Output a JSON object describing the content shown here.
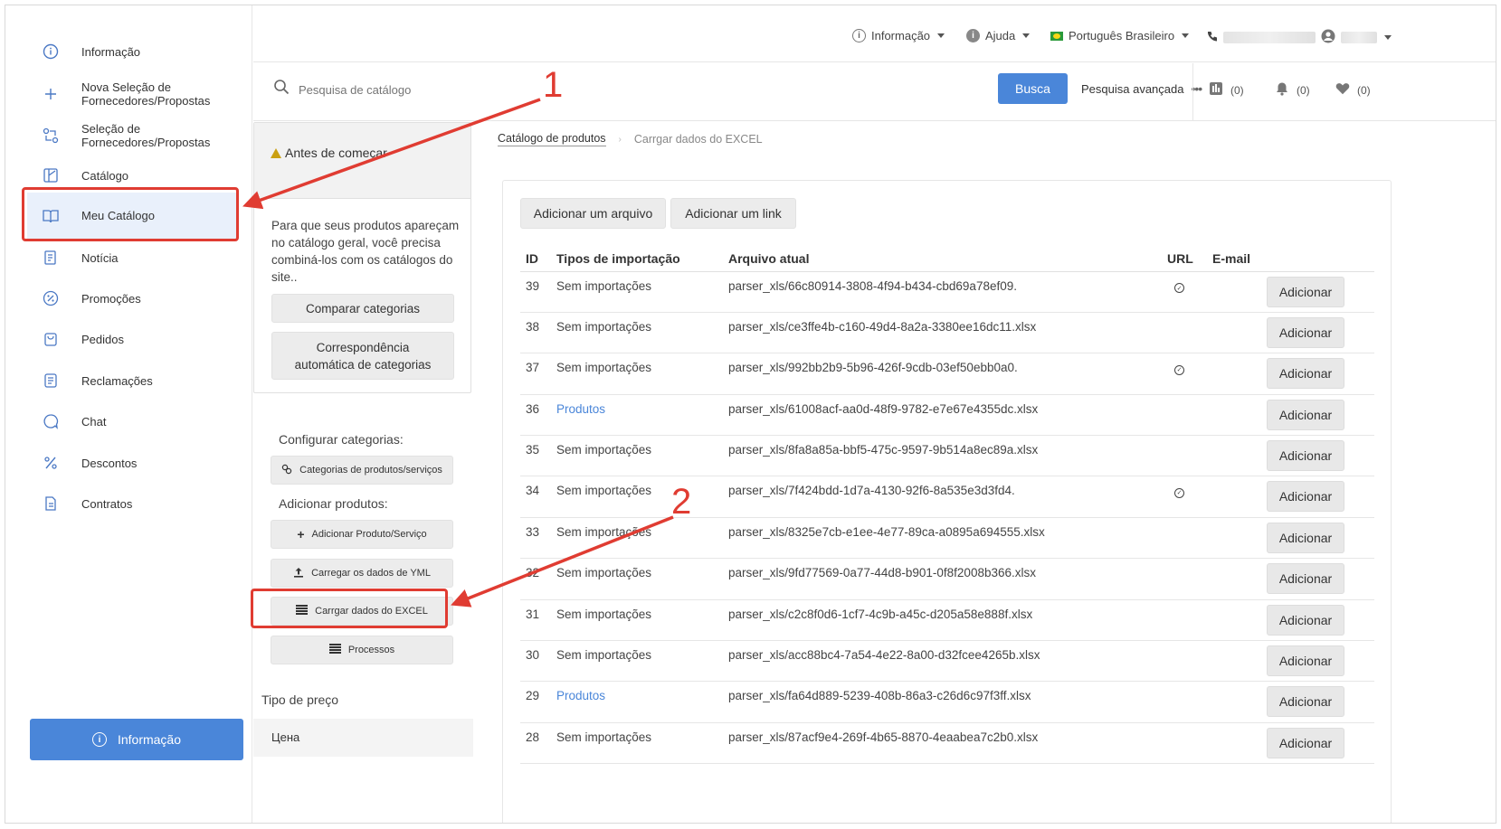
{
  "sidebar": {
    "items": [
      {
        "label": "Informação",
        "icon": "info-icon"
      },
      {
        "label": "Nova Seleção de Fornecedores/Propostas",
        "icon": "plus-icon"
      },
      {
        "label": "Seleção de Fornecedores/Propostas",
        "icon": "exchange-icon"
      },
      {
        "label": "Catálogo",
        "icon": "catalog-icon"
      },
      {
        "label": "Meu Catálogo",
        "icon": "book-icon"
      },
      {
        "label": "Notícia",
        "icon": "news-icon"
      },
      {
        "label": "Promoções",
        "icon": "percent-circle-icon"
      },
      {
        "label": "Pedidos",
        "icon": "bag-icon"
      },
      {
        "label": "Reclamações",
        "icon": "complaint-icon"
      },
      {
        "label": "Chat",
        "icon": "chat-icon"
      },
      {
        "label": "Descontos",
        "icon": "percent-icon"
      },
      {
        "label": "Contratos",
        "icon": "document-icon"
      }
    ],
    "info_button": "Informação",
    "active_item": "Meu Catálogo"
  },
  "header": {
    "info_menu": "Informação",
    "help_menu": "Ajuda",
    "language": "Português Brasileiro"
  },
  "search": {
    "placeholder": "Pesquisa de catálogo",
    "button": "Busca",
    "advanced": "Pesquisa avançada",
    "compare_count": "(0)",
    "notifications_count": "(0)",
    "favorites_count": "(0)"
  },
  "panel": {
    "before_title": "Antes de começar",
    "before_text": "Para que seus produtos apareçam no catálogo geral, você precisa combiná-los com os catálogos do site..",
    "compare_button": "Comparar categorias",
    "auto_match_button": "Correspondência automática de categorias",
    "configure_label": "Configurar categorias:",
    "categories_button": "Categorias de produtos/serviços",
    "add_products_label": "Adicionar produtos:",
    "add_product_button": "Adicionar Produto/Serviço",
    "yml_button": "Carregar os dados de YML",
    "excel_button": "Carrgar dados do EXCEL",
    "processes_button": "Processos",
    "price_type_label": "Tipo de preço",
    "price_type_value": "Цена"
  },
  "breadcrumb": {
    "parent": "Catálogo de produtos",
    "current": "Carrgar dados do EXCEL"
  },
  "content": {
    "add_file_button": "Adicionar um arquivo",
    "add_link_button": "Adicionar um link",
    "columns": [
      "ID",
      "Tipos de importação",
      "Arquivo atual",
      "URL",
      "E-mail"
    ],
    "row_button": "Adicionar",
    "rows": [
      {
        "id": "39",
        "type": "Sem importações",
        "file": "parser_xls/66c80914-3808-4f94-b434-cbd69a78ef09.",
        "url": true,
        "link": false
      },
      {
        "id": "38",
        "type": "Sem importações",
        "file": "parser_xls/ce3ffe4b-c160-49d4-8a2a-3380ee16dc11.xlsx",
        "url": false,
        "link": false
      },
      {
        "id": "37",
        "type": "Sem importações",
        "file": "parser_xls/992bb2b9-5b96-426f-9cdb-03ef50ebb0a0.",
        "url": true,
        "link": false
      },
      {
        "id": "36",
        "type": "Produtos",
        "file": "parser_xls/61008acf-aa0d-48f9-9782-e7e67e4355dc.xlsx",
        "url": false,
        "link": true
      },
      {
        "id": "35",
        "type": "Sem importações",
        "file": "parser_xls/8fa8a85a-bbf5-475c-9597-9b514a8ec89a.xlsx",
        "url": false,
        "link": false
      },
      {
        "id": "34",
        "type": "Sem importações",
        "file": "parser_xls/7f424bdd-1d7a-4130-92f6-8a535e3d3fd4.",
        "url": true,
        "link": false
      },
      {
        "id": "33",
        "type": "Sem importações",
        "file": "parser_xls/8325e7cb-e1ee-4e77-89ca-a0895a694555.xlsx",
        "url": false,
        "link": false
      },
      {
        "id": "32",
        "type": "Sem importações",
        "file": "parser_xls/9fd77569-0a77-44d8-b901-0f8f2008b366.xlsx",
        "url": false,
        "link": false
      },
      {
        "id": "31",
        "type": "Sem importações",
        "file": "parser_xls/c2c8f0d6-1cf7-4c9b-a45c-d205a58e888f.xlsx",
        "url": false,
        "link": false
      },
      {
        "id": "30",
        "type": "Sem importações",
        "file": "parser_xls/acc88bc4-7a54-4e22-8a00-d32fcee4265b.xlsx",
        "url": false,
        "link": false
      },
      {
        "id": "29",
        "type": "Produtos",
        "file": "parser_xls/fa64d889-5239-408b-86a3-c26d6c97f3ff.xlsx",
        "url": false,
        "link": true
      },
      {
        "id": "28",
        "type": "Sem importações",
        "file": "parser_xls/87acf9e4-269f-4b65-8870-4eaabea7c2b0.xlsx",
        "url": false,
        "link": false
      }
    ]
  },
  "annotations": {
    "step1": "1",
    "step2": "2",
    "color": "#e03c32"
  },
  "colors": {
    "accent": "#4a86d9",
    "link": "#4a86d9",
    "active_bg": "#e9f0fb"
  }
}
